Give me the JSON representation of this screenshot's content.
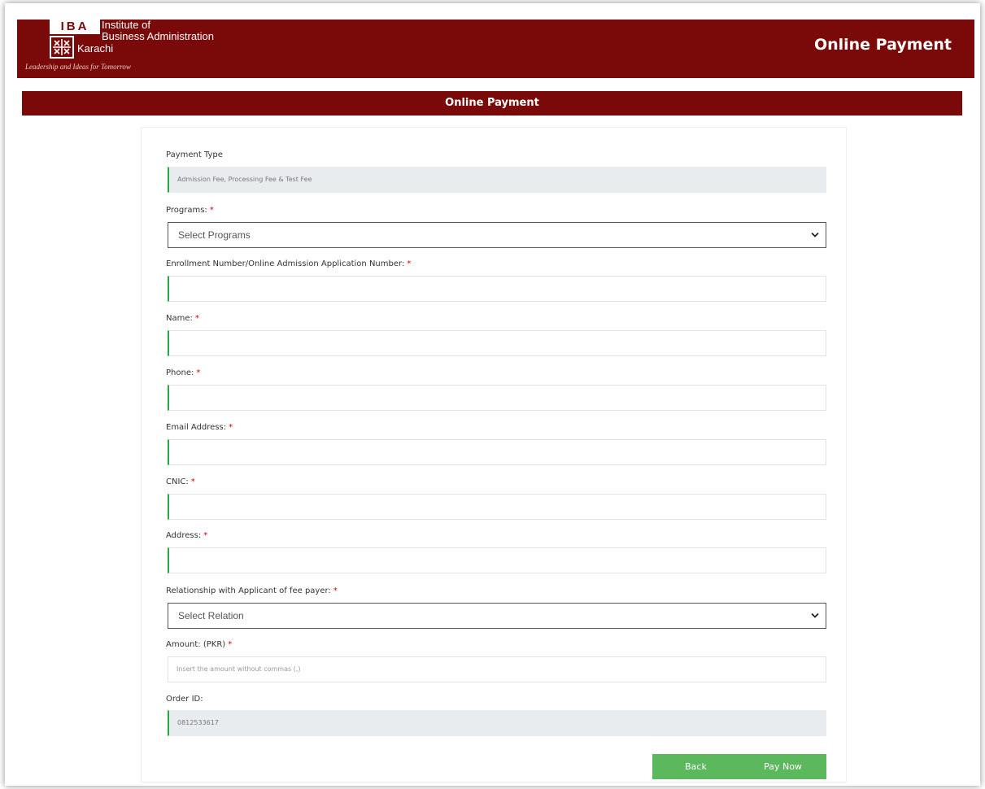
{
  "header": {
    "logo_abbr": "IBA",
    "logo_line1": "Institute of",
    "logo_line2": "Business Administration",
    "logo_line3": "Karachi",
    "tagline": "Leadership and Ideas for Tomorrow",
    "title": "Online Payment"
  },
  "subheader": {
    "title": "Online Payment"
  },
  "form": {
    "payment_type": {
      "label": "Payment Type",
      "value": "Admission Fee, Processing Fee & Test Fee"
    },
    "programs": {
      "label": "Programs:",
      "required": "*",
      "selected": "Select Programs"
    },
    "enrollment": {
      "label": "Enrollment Number/Online Admission Application Number:",
      "required": "*",
      "value": ""
    },
    "name": {
      "label": "Name:",
      "required": "*",
      "value": ""
    },
    "phone": {
      "label": "Phone:",
      "required": "*",
      "value": ""
    },
    "email": {
      "label": "Email Address:",
      "required": "*",
      "value": ""
    },
    "cnic": {
      "label": "CNIC:",
      "required": "*",
      "value": ""
    },
    "address": {
      "label": "Address:",
      "required": "*",
      "value": ""
    },
    "relationship": {
      "label": "Relationship with Applicant of fee payer:",
      "required": "*",
      "selected": "Select Relation"
    },
    "amount": {
      "label": "Amount: (PKR)",
      "required": "*",
      "placeholder": "Insert the amount without commas (,)"
    },
    "order_id": {
      "label": "Order ID:",
      "value": "0812533617"
    }
  },
  "buttons": {
    "back": "Back",
    "pay_now": "Pay Now"
  },
  "colors": {
    "brand": "#7a0a0a",
    "accent_green": "#28a745",
    "button_green": "#5cb85c",
    "required_red": "#d40000"
  },
  "icons": [
    "iba-logo-icon",
    "chevron-down-icon"
  ]
}
